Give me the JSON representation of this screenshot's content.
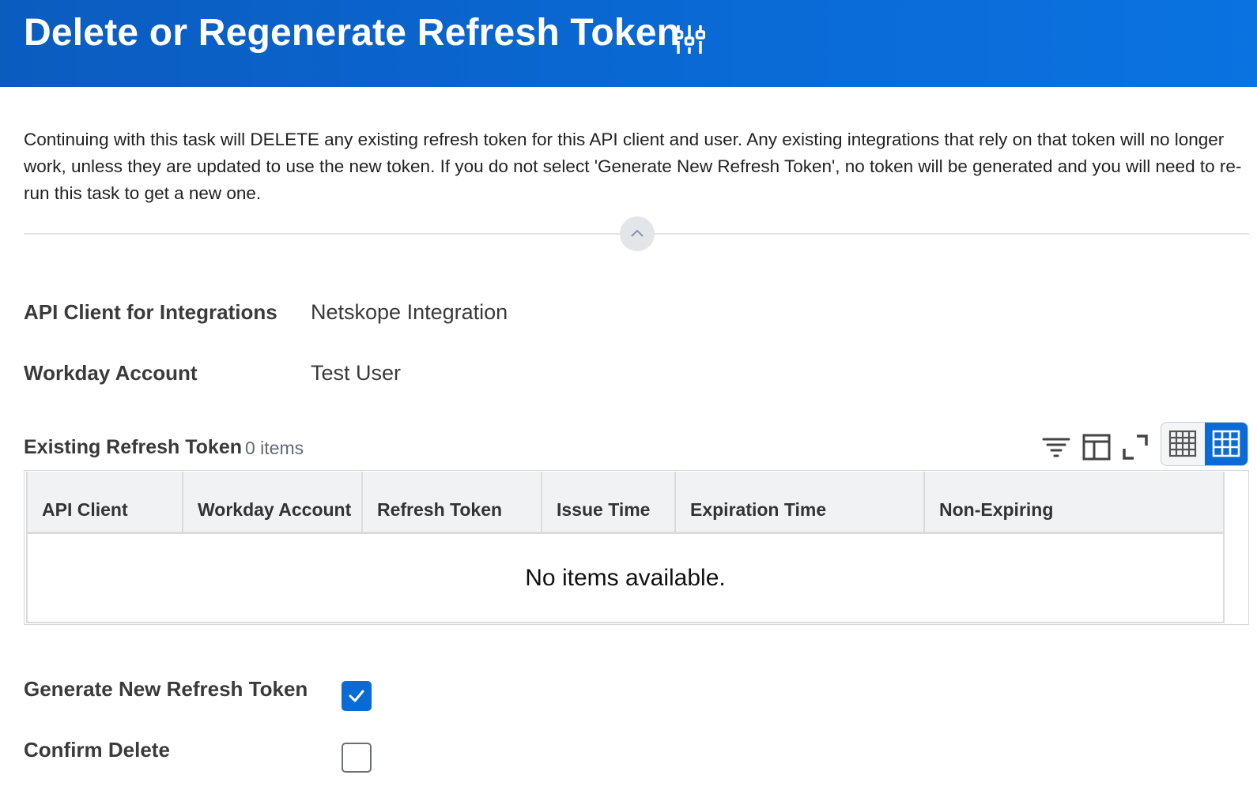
{
  "header": {
    "title": "Delete or Regenerate Refresh Token",
    "icon": "related-actions-icon"
  },
  "description": "Continuing with this task will DELETE any existing refresh token for this API client and user. Any existing integrations that rely on that token will no longer work, unless they are updated to use the new token. If you do not select 'Generate New Refresh Token', no token will be generated and you will need to re-run this task to get a new one.",
  "fields": {
    "api_client": {
      "label": "API Client for Integrations",
      "value": "Netskope Integration"
    },
    "workday_account": {
      "label": "Workday Account",
      "value": "Test User"
    }
  },
  "grid": {
    "title": "Existing Refresh Token",
    "count": "0 items",
    "toolbar_icons": [
      "filter-icon",
      "columns-icon",
      "fullscreen-icon",
      "table-view-icon",
      "grid-view-icon"
    ],
    "active_view": "grid-view",
    "columns": [
      "API Client",
      "Workday Account",
      "Refresh Token",
      "Issue Time",
      "Expiration Time",
      "Non-Expiring"
    ],
    "rows": [],
    "empty_message": "No items available."
  },
  "options": {
    "generate_new": {
      "label": "Generate New Refresh Token",
      "checked": true
    },
    "confirm_delete": {
      "label": "Confirm Delete",
      "checked": false
    }
  },
  "colors": {
    "header_bg": "#0a6ad6",
    "accent": "#0a6ad6",
    "text": "#333333"
  }
}
